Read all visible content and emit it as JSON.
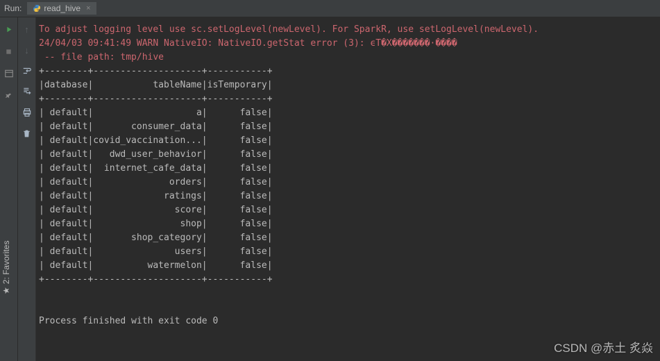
{
  "header": {
    "run_label": "Run:",
    "tab_label": "read_hive"
  },
  "side": {
    "favorites": "2: Favorites"
  },
  "watermark": "CSDN @赤土 炙焱",
  "log": {
    "l1": "To adjust logging level use sc.setLogLevel(newLevel). For SparkR, use setLogLevel(newLevel).",
    "l2": "24/04/03 09:41:49 WARN NativeIO: NativeIO.getStat error (3): ϵT�X�������·����",
    "l3": " -- file path: tmp/hive"
  },
  "table": {
    "border": "+--------+--------------------+-----------+",
    "header": "|database|           tableName|isTemporary|",
    "rows": [
      "| default|                   a|      false|",
      "| default|       consumer_data|      false|",
      "| default|covid_vaccination...|      false|",
      "| default|   dwd_user_behavior|      false|",
      "| default|  internet_cafe_data|      false|",
      "| default|              orders|      false|",
      "| default|             ratings|      false|",
      "| default|               score|      false|",
      "| default|                shop|      false|",
      "| default|       shop_category|      false|",
      "| default|               users|      false|",
      "| default|          watermelon|      false|"
    ]
  },
  "footer": {
    "exit": "Process finished with exit code 0"
  },
  "chart_data": {
    "type": "table",
    "columns": [
      "database",
      "tableName",
      "isTemporary"
    ],
    "rows": [
      [
        "default",
        "a",
        "false"
      ],
      [
        "default",
        "consumer_data",
        "false"
      ],
      [
        "default",
        "covid_vaccination...",
        "false"
      ],
      [
        "default",
        "dwd_user_behavior",
        "false"
      ],
      [
        "default",
        "internet_cafe_data",
        "false"
      ],
      [
        "default",
        "orders",
        "false"
      ],
      [
        "default",
        "ratings",
        "false"
      ],
      [
        "default",
        "score",
        "false"
      ],
      [
        "default",
        "shop",
        "false"
      ],
      [
        "default",
        "shop_category",
        "false"
      ],
      [
        "default",
        "users",
        "false"
      ],
      [
        "default",
        "watermelon",
        "false"
      ]
    ]
  }
}
